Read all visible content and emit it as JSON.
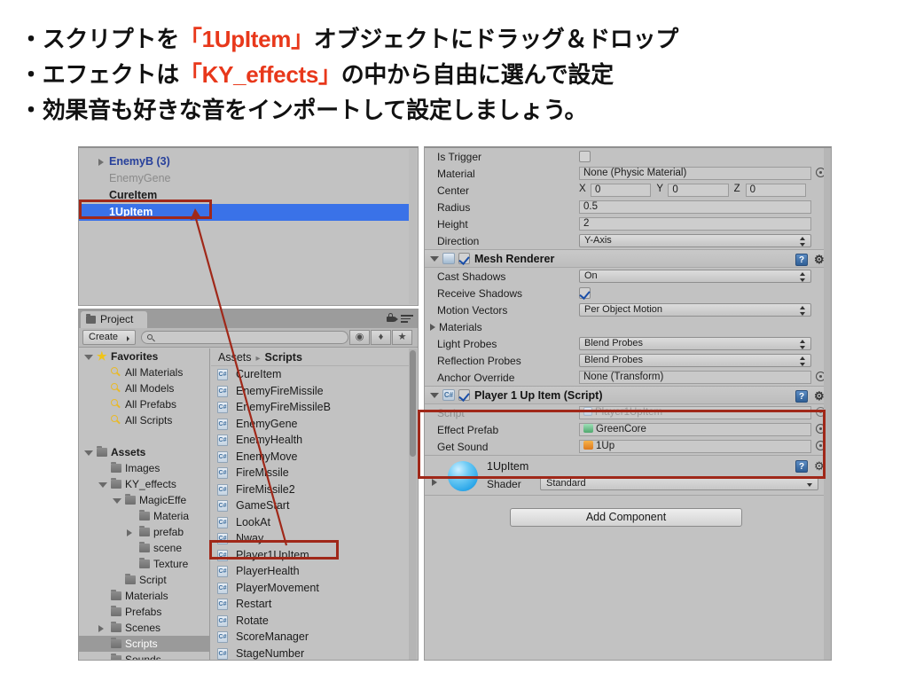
{
  "slide": {
    "lines": [
      {
        "parts": [
          {
            "t": "・スクリプトを",
            "hl": false
          },
          {
            "t": "「1UpItem」",
            "hl": true
          },
          {
            "t": "オブジェクトにドラッグ＆ドロップ",
            "hl": false
          }
        ]
      },
      {
        "parts": [
          {
            "t": "・エフェクトは",
            "hl": false
          },
          {
            "t": "「KY_effects」",
            "hl": true
          },
          {
            "t": "の中から自由に選んで設定",
            "hl": false
          }
        ]
      },
      {
        "parts": [
          {
            "t": "・効果音も好きな音をインポートして設定しましょう。",
            "hl": false
          }
        ]
      }
    ],
    "line1_a": "・スクリプトを",
    "line1_b": "「1UpItem」",
    "line1_c": "オブジェクトにドラッグ＆ドロップ",
    "line2_a": "・エフェクトは",
    "line2_b": "「KY_effects」",
    "line2_c": "の中から自由に選んで設定",
    "line3_a": "・効果音も好きな音をインポートして設定しましょう。",
    "highlight_color": "#e8381b"
  },
  "hierarchy": {
    "items": [
      {
        "label": "EnemyB (3)",
        "style": "prefab",
        "expandable": true
      },
      {
        "label": "EnemyGene",
        "style": "inactive",
        "expandable": false
      },
      {
        "label": "CureItem",
        "style": "normal",
        "expandable": false
      },
      {
        "label": "1UpItem",
        "style": "selected",
        "expandable": false
      }
    ]
  },
  "project": {
    "tab_label": "Project",
    "create_label": "Create",
    "search_placeholder": "",
    "toolbar_icons": [
      "filter-by-type-icon",
      "filter-by-label-icon",
      "favorite-star-icon"
    ],
    "breadcrumb": {
      "root": "Assets",
      "current": "Scripts"
    },
    "tree": [
      {
        "label": "Favorites",
        "icon": "star-icon",
        "indent": 0,
        "twirl": "open",
        "bold": true
      },
      {
        "label": "All Materials",
        "icon": "search-icon",
        "indent": 1,
        "twirl": "none",
        "bold": false
      },
      {
        "label": "All Models",
        "icon": "search-icon",
        "indent": 1,
        "twirl": "none",
        "bold": false
      },
      {
        "label": "All Prefabs",
        "icon": "search-icon",
        "indent": 1,
        "twirl": "none",
        "bold": false
      },
      {
        "label": "All Scripts",
        "icon": "search-icon",
        "indent": 1,
        "twirl": "none",
        "bold": false
      },
      {
        "label": "",
        "icon": "none",
        "indent": 0,
        "twirl": "none",
        "bold": false
      },
      {
        "label": "Assets",
        "icon": "folder-icon",
        "indent": 0,
        "twirl": "open",
        "bold": true
      },
      {
        "label": "Images",
        "icon": "folder-icon",
        "indent": 1,
        "twirl": "none",
        "bold": false
      },
      {
        "label": "KY_effects",
        "icon": "folder-icon",
        "indent": 1,
        "twirl": "open",
        "bold": false
      },
      {
        "label": "MagicEffe",
        "icon": "folder-icon",
        "indent": 2,
        "twirl": "open",
        "bold": false
      },
      {
        "label": "Materia",
        "icon": "folder-icon",
        "indent": 3,
        "twirl": "none",
        "bold": false
      },
      {
        "label": "prefab",
        "icon": "folder-icon",
        "indent": 3,
        "twirl": "closed",
        "bold": false
      },
      {
        "label": "scene",
        "icon": "folder-icon",
        "indent": 3,
        "twirl": "none",
        "bold": false
      },
      {
        "label": "Texture",
        "icon": "folder-icon",
        "indent": 3,
        "twirl": "none",
        "bold": false
      },
      {
        "label": "Script",
        "icon": "folder-icon",
        "indent": 2,
        "twirl": "none",
        "bold": false
      },
      {
        "label": "Materials",
        "icon": "folder-icon",
        "indent": 1,
        "twirl": "none",
        "bold": false
      },
      {
        "label": "Prefabs",
        "icon": "folder-icon",
        "indent": 1,
        "twirl": "none",
        "bold": false
      },
      {
        "label": "Scenes",
        "icon": "folder-icon",
        "indent": 1,
        "twirl": "closed",
        "bold": false
      },
      {
        "label": "Scripts",
        "icon": "folder-icon",
        "indent": 1,
        "twirl": "none",
        "bold": false,
        "selected": true
      },
      {
        "label": "Sounds",
        "icon": "folder-icon",
        "indent": 1,
        "twirl": "none",
        "bold": false
      }
    ],
    "assets": [
      "CureItem",
      "EnemyFireMissile",
      "EnemyFireMissileB",
      "EnemyGene",
      "EnemyHealth",
      "EnemyMove",
      "FireMissile",
      "FireMissile2",
      "GameStart",
      "LookAt",
      "Nway",
      "Player1UpItem",
      "PlayerHealth",
      "PlayerMovement",
      "Restart",
      "Rotate",
      "ScoreManager",
      "StageNumber"
    ],
    "asset_icon": "csharp-script-icon",
    "highlighted_asset": "Player1UpItem"
  },
  "inspector": {
    "collider": {
      "rows": [
        {
          "label": "Is Trigger",
          "type": "checkbox",
          "checked": false
        },
        {
          "label": "Material",
          "type": "object",
          "value": "None (Physic Material)"
        },
        {
          "label": "Center",
          "type": "vector3",
          "x": "0",
          "y": "0",
          "z": "0",
          "ax": "X",
          "ay": "Y",
          "az": "Z"
        },
        {
          "label": "Radius",
          "type": "text",
          "value": "0.5"
        },
        {
          "label": "Height",
          "type": "text",
          "value": "2"
        },
        {
          "label": "Direction",
          "type": "popup",
          "value": "Y-Axis"
        }
      ]
    },
    "mesh_renderer": {
      "title": "Mesh Renderer",
      "enabled": true,
      "help_label": "?",
      "gear_label": "⚙",
      "rows": [
        {
          "label": "Cast Shadows",
          "type": "popup",
          "value": "On"
        },
        {
          "label": "Receive Shadows",
          "type": "checkbox",
          "checked": true
        },
        {
          "label": "Motion Vectors",
          "type": "popup",
          "value": "Per Object Motion"
        },
        {
          "label": "Materials",
          "type": "foldout"
        },
        {
          "label": "Light Probes",
          "type": "popup",
          "value": "Blend Probes"
        },
        {
          "label": "Reflection Probes",
          "type": "popup",
          "value": "Blend Probes"
        },
        {
          "label": "Anchor Override",
          "type": "object",
          "value": "None (Transform)"
        }
      ]
    },
    "script_component": {
      "title": "Player 1 Up Item (Script)",
      "enabled": true,
      "rows": [
        {
          "label": "Script",
          "type": "object-dim",
          "value": "Player1UpItem"
        },
        {
          "label": "Effect Prefab",
          "type": "object",
          "value": "GreenCore",
          "icon": "prefab-cube-icon"
        },
        {
          "label": "Get Sound",
          "type": "object",
          "value": "1Up",
          "icon": "audioclip-icon"
        }
      ]
    },
    "material": {
      "name": "1UpItem",
      "shader_label": "Shader",
      "shader_value": "Standard"
    },
    "add_component_label": "Add Component"
  },
  "colors": {
    "unity_bg": "#c2c2c2",
    "selection_blue": "#3a72e8",
    "annotation_red": "#a02819",
    "prefab_blue": "#27409b"
  }
}
